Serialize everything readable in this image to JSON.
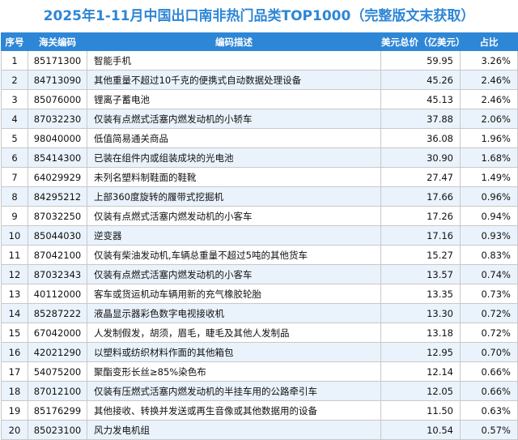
{
  "title": "2025年1-11月中国出口南非热门品类TOP1000（完整版文末获取）",
  "headers": {
    "idx": "序号",
    "code": "海关编码",
    "desc": "编码描述",
    "value": "美元总价（亿美元）",
    "share": "占比"
  },
  "rows": [
    {
      "idx": "1",
      "code": "85171300",
      "desc": "智能手机",
      "value": "59.95",
      "share": "3.26%"
    },
    {
      "idx": "2",
      "code": "84713090",
      "desc": "其他重量不超过10千克的便携式自动数据处理设备",
      "value": "45.26",
      "share": "2.46%"
    },
    {
      "idx": "3",
      "code": "85076000",
      "desc": "锂离子蓄电池",
      "value": "45.13",
      "share": "2.46%"
    },
    {
      "idx": "4",
      "code": "87032230",
      "desc": "仅装有点燃式活塞内燃发动机的小轿车",
      "value": "37.88",
      "share": "2.06%"
    },
    {
      "idx": "5",
      "code": "98040000",
      "desc": "低值简易通关商品",
      "value": "36.08",
      "share": "1.96%"
    },
    {
      "idx": "6",
      "code": "85414300",
      "desc": "已装在组件内或组装成块的光电池",
      "value": "30.90",
      "share": "1.68%"
    },
    {
      "idx": "7",
      "code": "64029929",
      "desc": "未列名塑料制鞋面的鞋靴",
      "value": "27.47",
      "share": "1.49%"
    },
    {
      "idx": "8",
      "code": "84295212",
      "desc": "上部360度旋转的履带式挖掘机",
      "value": "17.66",
      "share": "0.96%"
    },
    {
      "idx": "9",
      "code": "87032250",
      "desc": "仅装有点燃式活塞内燃发动机的小客车",
      "value": "17.26",
      "share": "0.94%"
    },
    {
      "idx": "10",
      "code": "85044030",
      "desc": "逆变器",
      "value": "17.16",
      "share": "0.93%"
    },
    {
      "idx": "11",
      "code": "87042100",
      "desc": "仅装有柴油发动机,车辆总重量不超过5吨的其他货车",
      "value": "15.27",
      "share": "0.83%"
    },
    {
      "idx": "12",
      "code": "87032343",
      "desc": "仅装有点燃式活塞内燃发动机的小客车",
      "value": "13.57",
      "share": "0.74%"
    },
    {
      "idx": "13",
      "code": "40112000",
      "desc": "客车或货运机动车辆用新的充气橡胶轮胎",
      "value": "13.35",
      "share": "0.73%"
    },
    {
      "idx": "14",
      "code": "85287222",
      "desc": "液晶显示器彩色数字电视接收机",
      "value": "13.30",
      "share": "0.72%"
    },
    {
      "idx": "15",
      "code": "67042000",
      "desc": "人发制假发，胡须，眉毛，睫毛及其他人发制品",
      "value": "13.18",
      "share": "0.72%"
    },
    {
      "idx": "16",
      "code": "42021290",
      "desc": "以塑料或纺织材料作面的其他箱包",
      "value": "12.95",
      "share": "0.70%"
    },
    {
      "idx": "17",
      "code": "54075200",
      "desc": "聚酯变形长丝≥85%染色布",
      "value": "12.14",
      "share": "0.66%"
    },
    {
      "idx": "18",
      "code": "87012100",
      "desc": "仅装有压燃式活塞内燃发动机的半挂车用的公路牵引车",
      "value": "12.05",
      "share": "0.66%"
    },
    {
      "idx": "19",
      "code": "85176299",
      "desc": "其他接收、转换并发送或再生音像或其他数据用的设备",
      "value": "11.50",
      "share": "0.63%"
    },
    {
      "idx": "20",
      "code": "85023100",
      "desc": "风力发电机组",
      "value": "10.54",
      "share": "0.57%"
    }
  ]
}
